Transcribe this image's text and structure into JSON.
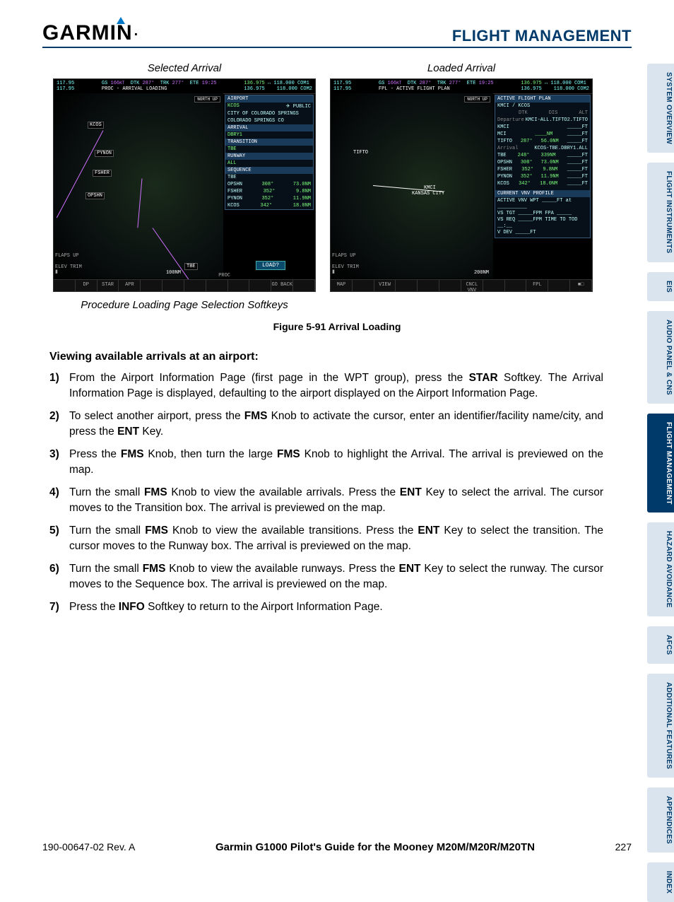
{
  "header": {
    "logo_text": "GARMIN",
    "section": "FLIGHT MANAGEMENT"
  },
  "tabs": [
    {
      "label": "SYSTEM OVERVIEW",
      "active": false
    },
    {
      "label": "FLIGHT INSTRUMENTS",
      "active": false
    },
    {
      "label": "EIS",
      "active": false
    },
    {
      "label": "AUDIO PANEL & CNS",
      "active": false
    },
    {
      "label": "FLIGHT MANAGEMENT",
      "active": true
    },
    {
      "label": "HAZARD AVOIDANCE",
      "active": false
    },
    {
      "label": "AFCS",
      "active": false
    },
    {
      "label": "ADDITIONAL FEATURES",
      "active": false
    },
    {
      "label": "APPENDICES",
      "active": false
    },
    {
      "label": "INDEX",
      "active": false
    }
  ],
  "figure_labels": {
    "left": "Selected Arrival",
    "right": "Loaded Arrival",
    "softkey_caption": "Procedure Loading Page Selection Softkeys",
    "caption": "Figure 5-91  Arrival Loading"
  },
  "screen_left": {
    "freq1": "117.95",
    "freq2": "117.95",
    "gs": "166",
    "gs_unit": "KT",
    "dtk": "287°",
    "trk": "277°",
    "ete": "19:25",
    "com1": "136.975",
    "com1b": "118.000",
    "com2": "136.975",
    "com2b": "118.000",
    "page_title": "PROC - ARRIVAL LOADING",
    "north": "NORTH UP",
    "airport_hdr": "AIRPORT",
    "airport_code": "KCOS",
    "airport_type": "PUBLIC",
    "airport_name": "CITY OF COLORADO SPRINGS",
    "airport_city": "COLORADO SPRINGS CO",
    "arrival_hdr": "ARRIVAL",
    "arrival": "DBRY1",
    "transition_hdr": "TRANSITION",
    "transition": "TBE",
    "runway_hdr": "RUNWAY",
    "runway": "ALL",
    "sequence_hdr": "SEQUENCE",
    "sequence": [
      {
        "wp": "TBE",
        "crs": "",
        "dist": ""
      },
      {
        "wp": "OPSHN",
        "crs": "308°",
        "dist": "73.0NM"
      },
      {
        "wp": "FSHER",
        "crs": "352°",
        "dist": "9.8NM"
      },
      {
        "wp": "PYNON",
        "crs": "352°",
        "dist": "11.9NM"
      },
      {
        "wp": "KCOS",
        "crs": "342°",
        "dist": "18.0NM"
      }
    ],
    "waypoints_map": [
      "KCOS",
      "PYNON",
      "FSHER",
      "OPSHN",
      "TBE"
    ],
    "flaps": "FLAPS\nUP",
    "elev": "ELEV\nTRIM",
    "range": "100NM",
    "load": "LOAD?",
    "softkeys": [
      "",
      "DP",
      "STAR",
      "APR",
      "",
      "",
      "",
      "",
      "",
      "",
      "GO BACK",
      ""
    ],
    "softkeys_row2_left": "PROC"
  },
  "screen_right": {
    "freq1": "117.95",
    "freq2": "117.95",
    "gs": "166",
    "gs_unit": "KT",
    "dtk": "287°",
    "trk": "277°",
    "ete": "19:25",
    "com1": "136.975",
    "com1b": "118.000",
    "com2": "136.975",
    "com2b": "118.000",
    "page_title": "FPL - ACTIVE FLIGHT PLAN",
    "north": "NORTH UP",
    "fpl_hdr": "ACTIVE FLIGHT PLAN",
    "fpl_route": "KMCI / KCOS",
    "cols": [
      "",
      "DTK",
      "DIS",
      "ALT"
    ],
    "departure_hdr": "Departure",
    "departure": "KMCI-ALL.TIFTO2.TIFTO",
    "legs": [
      {
        "wp": "KMCI",
        "dtk": "",
        "dis": "",
        "alt": "_____FT"
      },
      {
        "wp": "MCI",
        "dtk": "",
        "dis": "____NM",
        "alt": "_____FT"
      },
      {
        "wp": "TIFTO",
        "dtk": "287°",
        "dis": "56.0NM",
        "alt": "_____FT"
      }
    ],
    "arrival_hdr": "Arrival",
    "arrival": "KCOS-TBE.DBRY1.ALL",
    "arr_legs": [
      {
        "wp": "TBE",
        "dtk": "248°",
        "dis": "339NM",
        "alt": "_____FT"
      },
      {
        "wp": "OPSHN",
        "dtk": "308°",
        "dis": "73.0NM",
        "alt": "_____FT"
      },
      {
        "wp": "FSHER",
        "dtk": "352°",
        "dis": "9.8NM",
        "alt": "_____FT"
      },
      {
        "wp": "PYNON",
        "dtk": "352°",
        "dis": "11.9NM",
        "alt": "_____FT"
      },
      {
        "wp": "KCOS",
        "dtk": "342°",
        "dis": "18.0NM",
        "alt": "_____FT"
      }
    ],
    "vnv_hdr": "CURRENT VNV PROFILE",
    "vnv": [
      "ACTIVE VNV WPT  _____FT at __________",
      "VS TGT   _____FPM  FPA  _____",
      "VS REQ   _____FPM  TIME TO TOD  __:__",
      "V DEV    _____FT"
    ],
    "map_labels": [
      "KANSAS CITY",
      "TIFTO",
      "KMCI"
    ],
    "flaps": "FLAPS\nUP",
    "elev": "ELEV\nTRIM",
    "range": "200NM",
    "softkeys": [
      "MAP",
      "",
      "VIEW",
      "",
      "",
      "",
      "CNCL VNV",
      "",
      "",
      "FPL",
      "",
      "■□"
    ]
  },
  "procedure": {
    "heading": "Viewing available arrivals at an airport:",
    "steps": [
      {
        "n": "1)",
        "html": "From the Airport Information Page (first page in the WPT group), press the <b>STAR</b> Softkey.  The Arrival Information Page is displayed, defaulting to the airport displayed on the Airport Information Page."
      },
      {
        "n": "2)",
        "html": "To select another airport, press the <b>FMS</b> Knob to activate the cursor, enter an identifier/facility name/city, and press the <b>ENT</b> Key."
      },
      {
        "n": "3)",
        "html": "Press the <b>FMS</b> Knob, then turn the large <b>FMS</b> Knob to highlight the Arrival.  The arrival is previewed on the map."
      },
      {
        "n": "4)",
        "html": "Turn the small <b>FMS</b> Knob to view the available arrivals. Press the <b>ENT</b> Key to select the arrival.  The cursor moves to the Transition box.  The arrival is previewed on the map."
      },
      {
        "n": "5)",
        "html": "Turn the small <b>FMS</b> Knob to view the available transitions. Press the <b>ENT</b> Key to select the transition.  The cursor moves to the Runway box.  The arrival is previewed on the map."
      },
      {
        "n": "6)",
        "html": "Turn the small <b>FMS</b> Knob to view the available runways. Press the <b>ENT</b> Key to select the runway.  The cursor moves to the Sequence box.  The arrival is previewed on the map."
      },
      {
        "n": "7)",
        "html": "Press the <b>INFO</b> Softkey to return to the Airport Information Page."
      }
    ]
  },
  "footer": {
    "left": "190-00647-02  Rev. A",
    "mid": "Garmin G1000 Pilot's Guide for the Mooney M20M/M20R/M20TN",
    "right": "227"
  }
}
